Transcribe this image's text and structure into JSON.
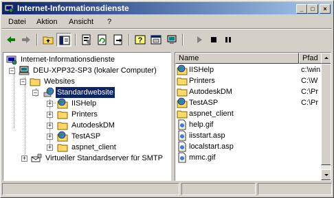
{
  "window": {
    "title": "Internet-Informationsdienste",
    "controls": {
      "minimize": "_",
      "maximize": "□",
      "close": "×"
    }
  },
  "menubar": {
    "items": [
      "Datei",
      "Aktion",
      "Ansicht",
      "?"
    ]
  },
  "toolbar": {
    "buttons": [
      "back-icon",
      "forward-icon",
      "up-folder-icon",
      "show-tree-icon",
      "properties-icon",
      "refresh-icon",
      "export-icon",
      "help-icon",
      "settings-icon",
      "computer-icon",
      "play-icon",
      "stop-icon",
      "pause-icon"
    ]
  },
  "tree": {
    "root": "Internet-Informationsdienste",
    "computer": "DEU-XPP32-SP3 (lokaler Computer)",
    "websites": "Websites",
    "default_site": "Standardwebsite",
    "children": [
      "IISHelp",
      "Printers",
      "AutodeskDM",
      "TestASP",
      "aspnet_client"
    ],
    "smtp": "Virtueller Standardserver für SMTP"
  },
  "list": {
    "columns": {
      "name": "Name",
      "path": "Pfad"
    },
    "rows": [
      {
        "name": "IISHelp",
        "path": "c:\\win",
        "icon": "globe-folder-icon"
      },
      {
        "name": "Printers",
        "path": "C:\\W",
        "icon": "folder-icon"
      },
      {
        "name": "AutodeskDM",
        "path": "C:\\Pr",
        "icon": "folder-icon"
      },
      {
        "name": "TestASP",
        "path": "C:\\Pr",
        "icon": "globe-folder-icon"
      },
      {
        "name": "aspnet_client",
        "path": "",
        "icon": "folder-icon"
      },
      {
        "name": "help.gif",
        "path": "",
        "icon": "file-icon"
      },
      {
        "name": "iisstart.asp",
        "path": "",
        "icon": "file-icon"
      },
      {
        "name": "localstart.asp",
        "path": "",
        "icon": "file-icon"
      },
      {
        "name": "mmc.gif",
        "path": "",
        "icon": "file-icon"
      }
    ]
  },
  "status": {
    "panels": [
      "",
      "",
      ""
    ]
  },
  "colors": {
    "title_start": "#0a246a",
    "title_end": "#a6caf0",
    "selection": "#0a246a"
  }
}
